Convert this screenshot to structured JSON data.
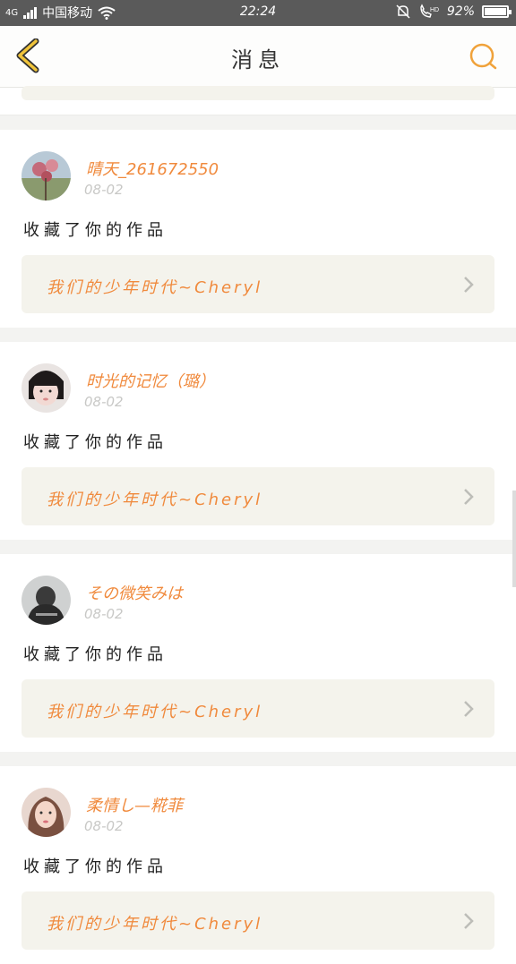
{
  "status": {
    "network": "4G",
    "carrier": "中国移动",
    "time": "22:24",
    "hd": "HD",
    "battery_pct": "92%",
    "battery_level": 0.92
  },
  "header": {
    "title": "消息",
    "back_icon": "chevron-left-icon",
    "search_icon": "search-icon",
    "accent": "#f0a23a"
  },
  "messages": [
    {
      "user": "晴天_261672550",
      "date": "08-02",
      "action": "收藏了你的作品",
      "work": "我们的少年时代~Cheryl"
    },
    {
      "user": "时光的记忆（璐）",
      "date": "08-02",
      "action": "收藏了你的作品",
      "work": "我们的少年时代~Cheryl"
    },
    {
      "user": "その微笑みは",
      "date": "08-02",
      "action": "收藏了你的作品",
      "work": "我们的少年时代~Cheryl"
    },
    {
      "user": "柔情し—糀菲",
      "date": "08-02",
      "action": "收藏了你的作品",
      "work": "我们的少年时代~Cheryl"
    }
  ],
  "colors": {
    "username": "#f08a3d",
    "link_bg": "#f4f3ec",
    "status_bg": "#5a5a5a"
  }
}
